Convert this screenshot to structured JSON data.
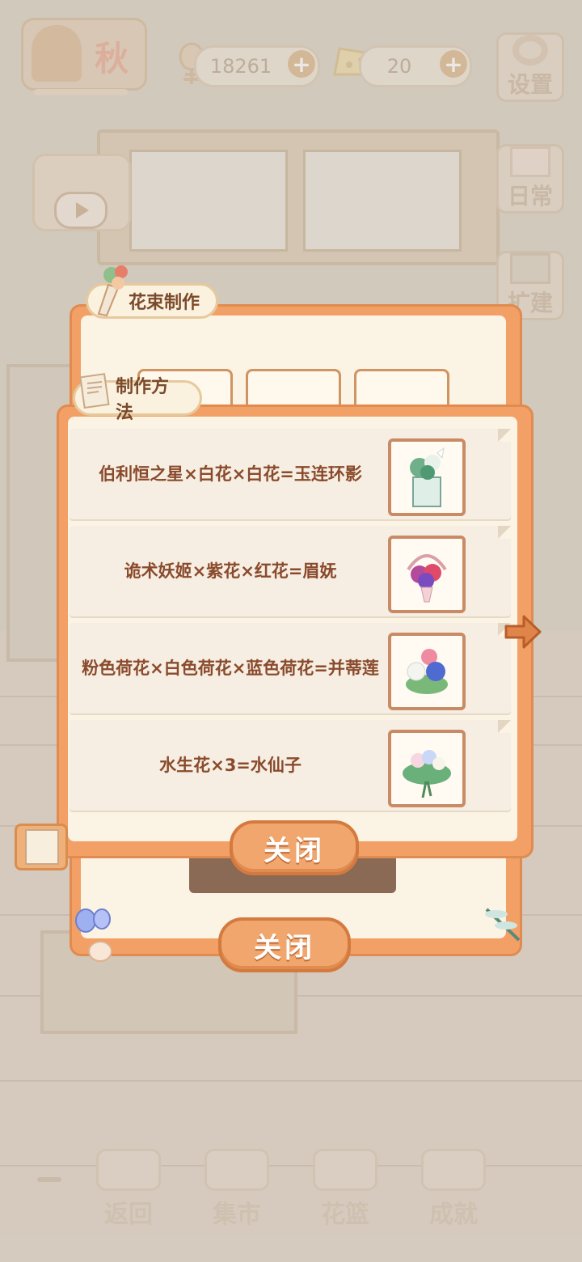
{
  "hud": {
    "season": "秋",
    "coins": "18261",
    "cheese": "20",
    "settings_label": "设置",
    "daily_label": "日常",
    "build_label": "扩建"
  },
  "bottom_nav": [
    {
      "label": "返回"
    },
    {
      "label": "集市"
    },
    {
      "label": "花篮"
    },
    {
      "label": "成就"
    }
  ],
  "bouquet_panel": {
    "title": "花束制作",
    "close_label": "关闭"
  },
  "recipes_panel": {
    "title": "制作方法",
    "close_label": "关闭",
    "recipes": [
      {
        "text": "伯利恒之星×白花×白花=玉连环影"
      },
      {
        "text": "诡术妖姬×紫花×红花=眉妩"
      },
      {
        "text": "粉色荷花×白色荷花×蓝色荷花=并蒂莲"
      },
      {
        "text": "水生花×3=水仙子"
      }
    ]
  },
  "colors": {
    "panel_orange": "#f2a066",
    "text_brown": "#8a4a2c"
  }
}
